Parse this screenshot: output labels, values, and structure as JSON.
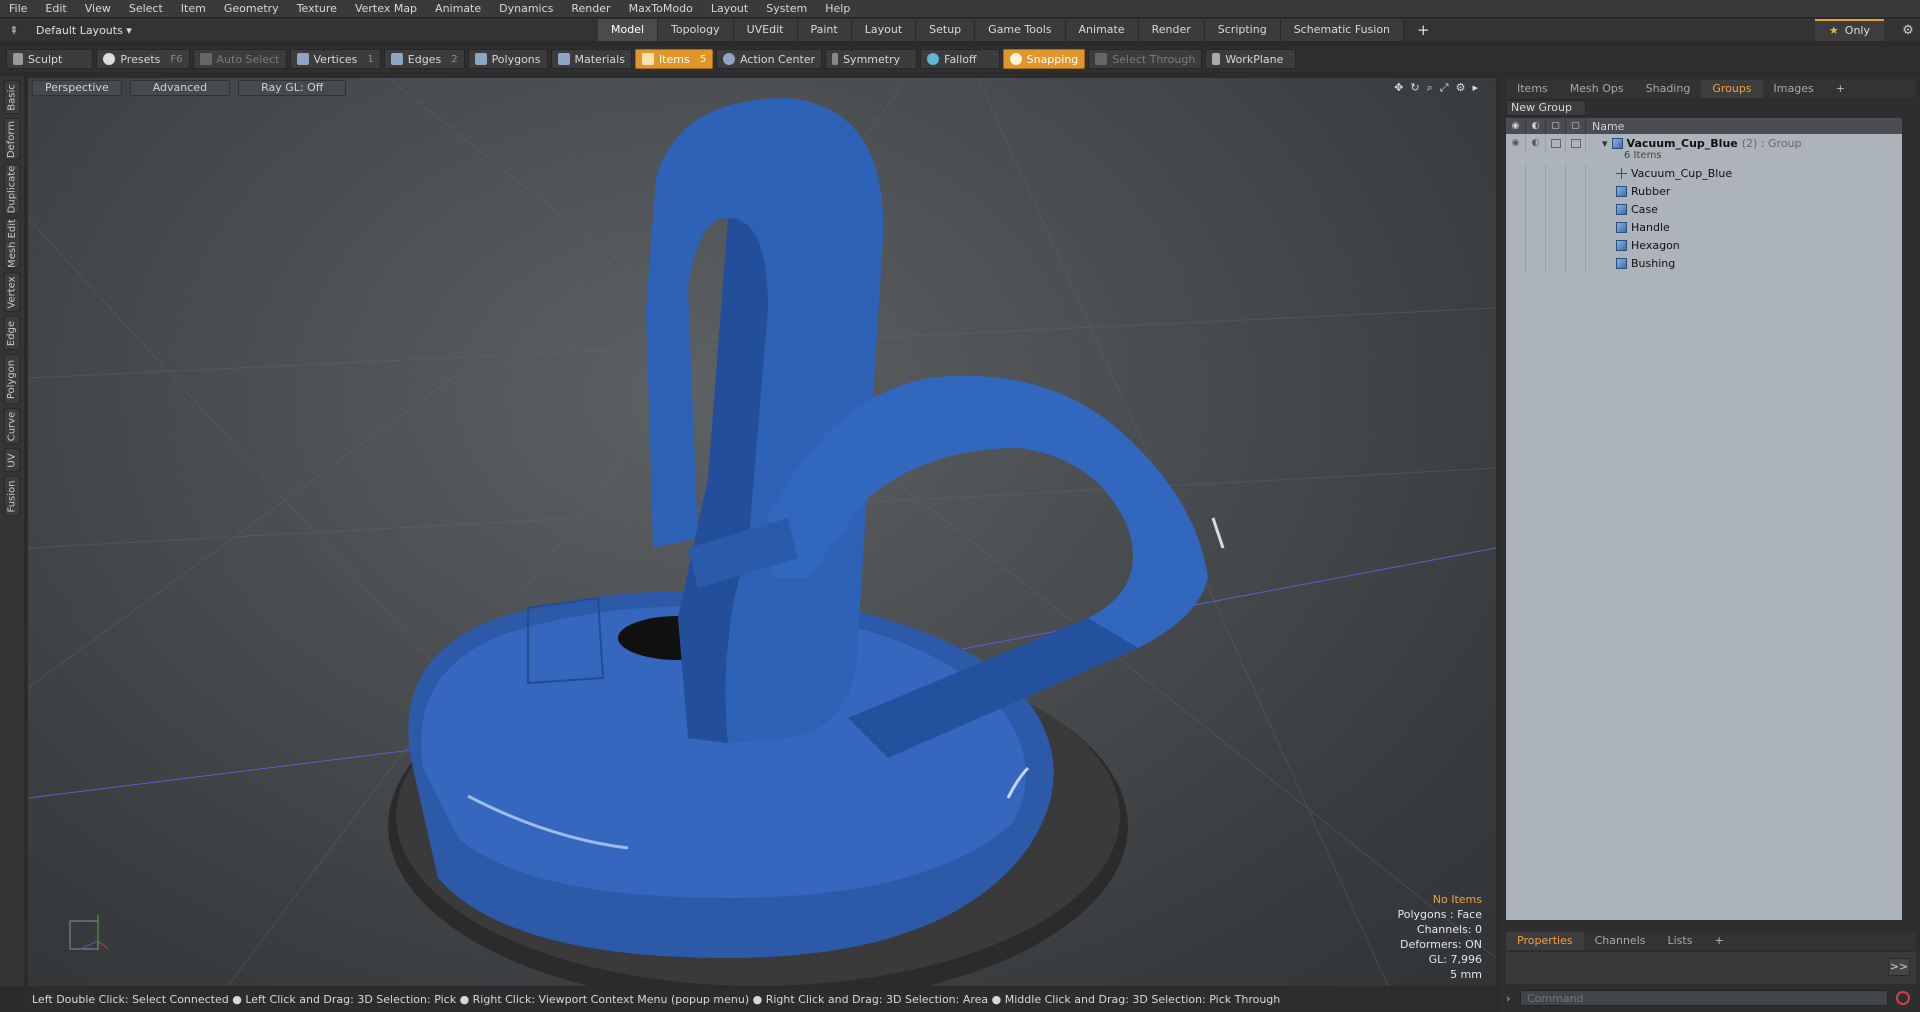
{
  "menu": [
    "File",
    "Edit",
    "View",
    "Select",
    "Item",
    "Geometry",
    "Texture",
    "Vertex Map",
    "Animate",
    "Dynamics",
    "Render",
    "MaxToModo",
    "Layout",
    "System",
    "Help"
  ],
  "layout": {
    "selector": "Default Layouts ▾",
    "tabs": [
      "Model",
      "Topology",
      "UVEdit",
      "Paint",
      "Layout",
      "Setup",
      "Game Tools",
      "Animate",
      "Render",
      "Scripting",
      "Schematic Fusion"
    ],
    "active_tab": "Model",
    "add_tab": "+",
    "only_label": "Only"
  },
  "toolbar": {
    "sculpt": "Sculpt",
    "presets": "Presets",
    "presets_key": "F6",
    "auto_select": "Auto Select",
    "vertices": "Vertices",
    "vertices_key": "1",
    "edges": "Edges",
    "edges_key": "2",
    "polygons": "Polygons",
    "materials": "Materials",
    "items": "Items",
    "items_key": "5",
    "action_center": "Action Center",
    "symmetry": "Symmetry",
    "falloff": "Falloff",
    "snapping": "Snapping",
    "select_through": "Select Through",
    "workplane": "WorkPlane"
  },
  "left_tabs": [
    "Basic",
    "Deform",
    "Duplicate",
    "Mesh Edit",
    "Vertex",
    "Edge",
    "Polygon",
    "Curve",
    "UV",
    "Fusion"
  ],
  "viewport": {
    "view_mode": "Perspective",
    "shading": "Advanced",
    "raygl": "Ray GL: Off",
    "info": {
      "selection": "No Items",
      "polygons": "Polygons : Face",
      "channels": "Channels: 0",
      "deformers": "Deformers: ON",
      "gl": "GL: 7,996",
      "unit": "5 mm"
    }
  },
  "statusbar": "Left Double Click: Select Connected ● Left Click and Drag: 3D Selection: Pick ● Right Click: Viewport Context Menu (popup menu) ● Right Click and Drag: 3D Selection: Area ● Middle Click and Drag: 3D Selection: Pick Through",
  "right_panel": {
    "tabs": [
      "Items",
      "Mesh Ops",
      "Shading",
      "Groups",
      "Images"
    ],
    "active_tab": "Groups",
    "add_tab": "+",
    "new_group": "New Group",
    "column_name": "Name",
    "group": {
      "name": "Vacuum_Cup_Blue",
      "count_type": "(2) : Group",
      "subcount": "6 Items",
      "children": [
        {
          "name": "Vacuum_Cup_Blue",
          "icon": "locator-icon"
        },
        {
          "name": "Rubber",
          "icon": "mesh-icon"
        },
        {
          "name": "Case",
          "icon": "mesh-icon"
        },
        {
          "name": "Handle",
          "icon": "mesh-icon"
        },
        {
          "name": "Hexagon",
          "icon": "mesh-icon"
        },
        {
          "name": "Bushing",
          "icon": "mesh-icon"
        }
      ]
    },
    "bottom_tabs": [
      "Properties",
      "Channels",
      "Lists"
    ],
    "bottom_active": "Properties",
    "bottom_add": "+",
    "command_placeholder": "Command",
    "expand": ">>"
  },
  "colors": {
    "accent": "#e0962a",
    "model_blue": "#2f64b8",
    "rubber": "#2a2a2a"
  }
}
